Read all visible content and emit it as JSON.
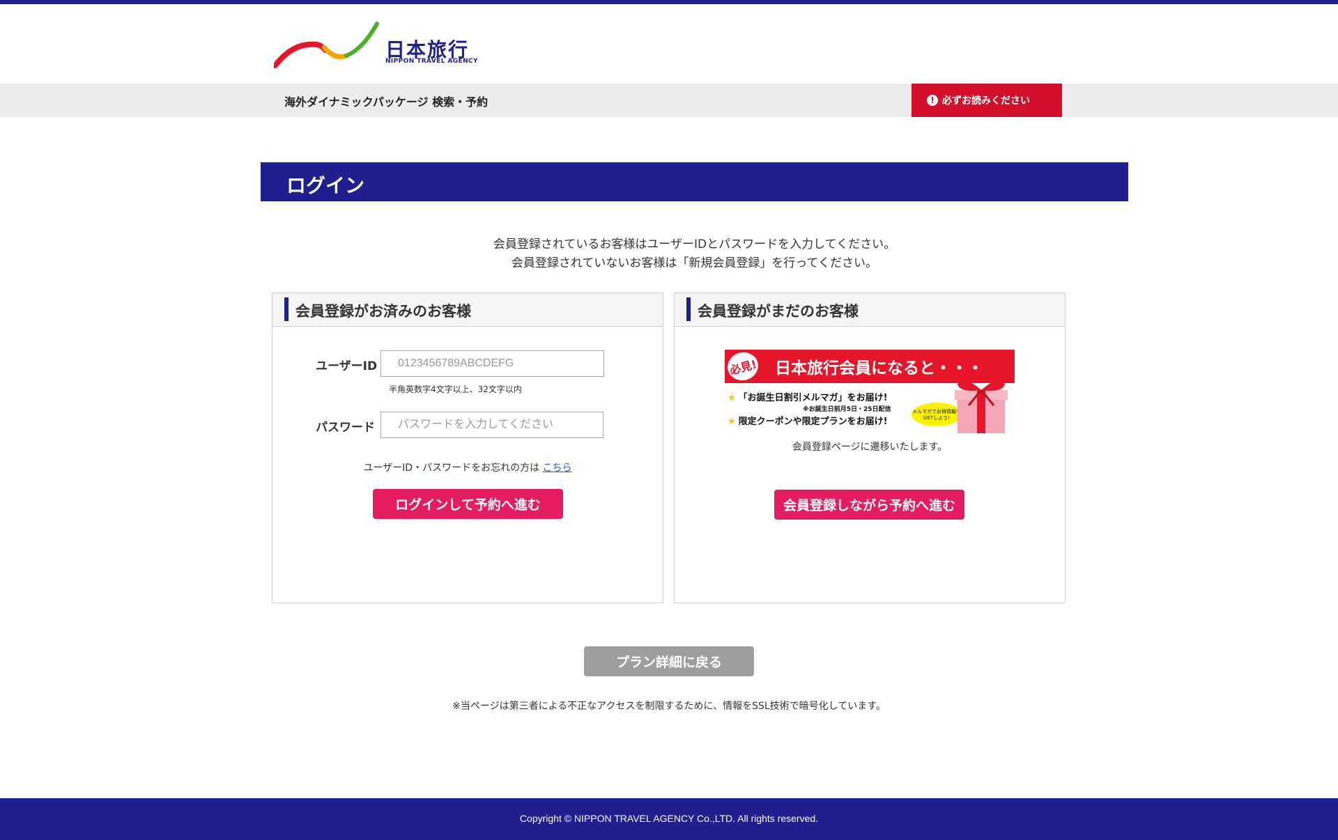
{
  "header": {
    "logo_name": "日本旅行",
    "logo_sub": "NIPPON TRAVEL AGENCY",
    "subnav_title": "海外ダイナミックパッケージ 検索・予約",
    "notice_button": "必ずお読みください"
  },
  "page": {
    "title": "ログイン",
    "intro_line1": "会員登録されているお客様はユーザーIDとパスワードを入力してください。",
    "intro_line2": "会員登録されていないお客様は「新規会員登録」を行ってください。"
  },
  "member_panel": {
    "heading": "会員登録がお済みのお客様",
    "userid_label": "ユーザーID",
    "userid_placeholder": "0123456789ABCDEFG",
    "userid_hint": "半角英数字4文字以上、32文字以内",
    "password_label": "パスワード",
    "password_placeholder": "パスワードを入力してください",
    "forgot_text": "ユーザーID・パスワードをお忘れの方は",
    "forgot_link": "こちら",
    "login_button": "ログインして予約へ進む"
  },
  "guest_panel": {
    "heading": "会員登録がまだのお客様",
    "banner": {
      "badge": "必見!",
      "title": "日本旅行会員になると・・・",
      "line1": "「お誕生日割引メルマガ」をお届け!",
      "note": "※お誕生日前月5日・25日配信",
      "line2": "限定クーポンや限定プランをお届け!",
      "bubble": "メルマガでお得情報をGETしよう!"
    },
    "redirect_text": "会員登録ページに遷移いたします。",
    "register_button": "会員登録しながら予約へ進む"
  },
  "back_button": "プラン詳細に戻る",
  "ssl_note": "※当ページは第三者による不正なアクセスを制限するために、情報をSSL技術で暗号化しています。",
  "footer": {
    "copyright": "Copyright © NIPPON TRAVEL AGENCY Co.,LTD. All rights reserved."
  },
  "colors": {
    "brand_navy": "#1f1f8f",
    "notice_red": "#d10f2a",
    "action_pink": "#e41c62",
    "back_gray": "#9e9e9e"
  }
}
